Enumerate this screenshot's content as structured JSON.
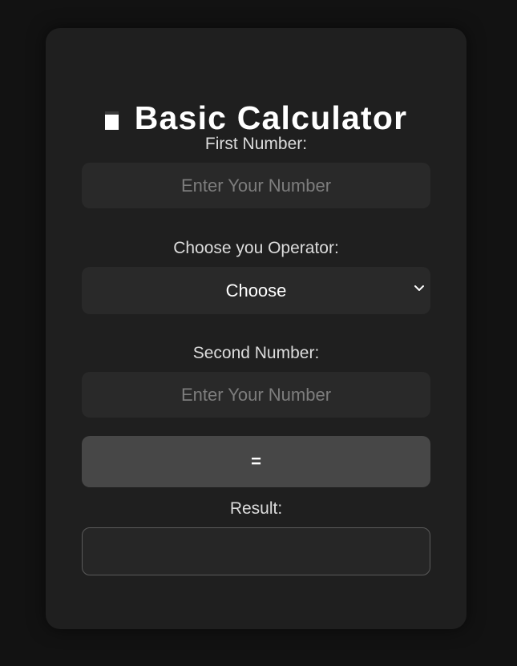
{
  "app": {
    "title": "Basic Calculator",
    "title_icon": "calculator-icon"
  },
  "first_number": {
    "label": "First Number:",
    "placeholder": "Enter Your Number",
    "value": ""
  },
  "operator": {
    "label": "Choose you Operator:",
    "selected": "Choose",
    "icon": "chevron-down-icon"
  },
  "second_number": {
    "label": "Second Number:",
    "placeholder": "Enter Your Number",
    "value": ""
  },
  "equals_button": {
    "label": "="
  },
  "result": {
    "label": "Result:",
    "value": ""
  },
  "colors": {
    "page_background": "#121212",
    "card_background": "#1f1f1f",
    "field_background": "#292929",
    "button_background": "#474747",
    "text": "#ffffff"
  }
}
